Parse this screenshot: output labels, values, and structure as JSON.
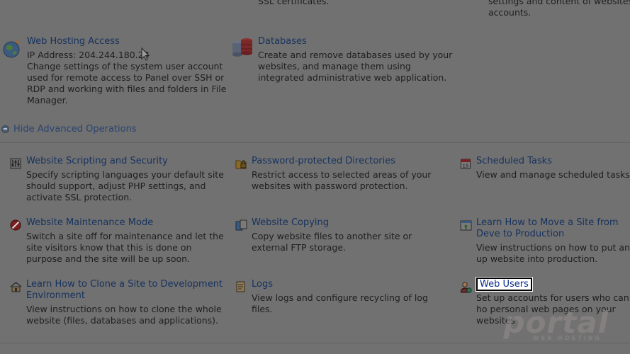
{
  "top_fragments": {
    "ssl": "SSL certificates.",
    "right_line1": "settings and content of websites a",
    "right_line2": "accounts."
  },
  "web_hosting": {
    "title": "Web Hosting Access",
    "ip": "IP Address: 204.244.180.23",
    "desc": "Change settings of the system user account used for remote access to Panel over SSH or RDP and working with files and folders in File Manager."
  },
  "databases": {
    "title": "Databases",
    "desc": "Create and remove databases used by your websites, and manage them using integrated administrative web application."
  },
  "advanced": {
    "label": "Hide Advanced Operations"
  },
  "items": {
    "scripting": {
      "title": "Website Scripting and Security",
      "desc": "Specify scripting languages your default site should support, adjust PHP settings, and activate SSL protection."
    },
    "password_dirs": {
      "title": "Password-protected Directories",
      "desc": "Restrict access to selected areas of your websites with password protection."
    },
    "scheduled": {
      "title": "Scheduled Tasks",
      "desc": "View and manage scheduled tasks."
    },
    "maintenance": {
      "title": "Website Maintenance Mode",
      "desc": "Switch a site off for maintenance and let the site visitors know that this is done on purpose and the site will be up soon."
    },
    "copying": {
      "title": "Website Copying",
      "desc": "Copy website files to another site or external FTP storage."
    },
    "move_site": {
      "title": "Learn How to Move a Site from Deve to Production",
      "desc": "View instructions on how to put an up website into production."
    },
    "clone_site": {
      "title": "Learn How to Clone a Site to Development Environment",
      "desc": "View instructions on how to clone the whole website (files, databases and applications)."
    },
    "logs": {
      "title": "Logs",
      "desc": "View logs and configure recycling of log files."
    },
    "web_users": {
      "title": "Web Users",
      "desc": "Set up accounts for users who can ho personal web pages on your websites"
    }
  },
  "watermark": {
    "main": "portal",
    "sub": "WEB HOSTING"
  },
  "colors": {
    "highlight_bg": "#ffffff",
    "link": "#16325e",
    "overlay": "#717171"
  }
}
